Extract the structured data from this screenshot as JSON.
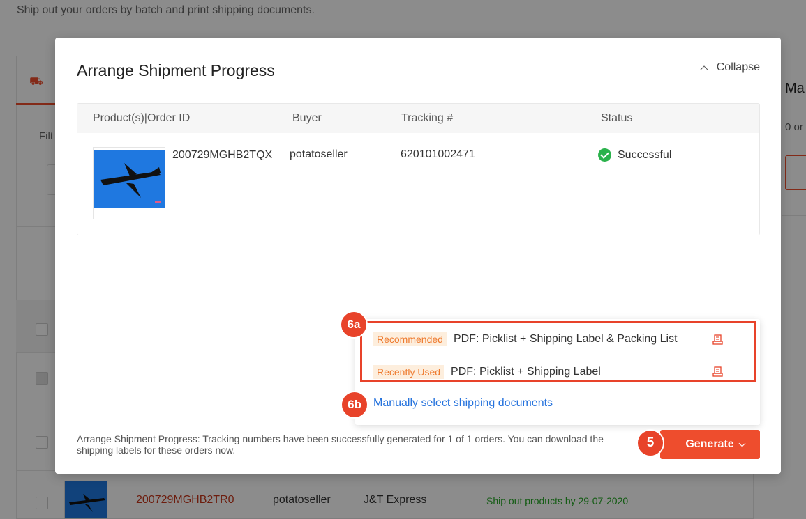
{
  "background": {
    "subtitle": "Ship out your orders by batch and print shipping documents.",
    "filter_label": "Filt",
    "right_title": "Ma",
    "right_count": "0 or",
    "row": {
      "order_id": "200729MGHB2TR0",
      "buyer": "potatoseller",
      "carrier": "J&T Express",
      "ship_by": "Ship out products by 29-07-2020"
    }
  },
  "modal": {
    "title": "Arrange Shipment Progress",
    "collapse_label": "Collapse",
    "table": {
      "headers": [
        "Product(s)|Order ID",
        "Buyer",
        "Tracking #",
        "Status"
      ],
      "rows": [
        {
          "order_id": "200729MGHB2TQX",
          "buyer": "potatoseller",
          "tracking": "620101002471",
          "status": "Successful"
        }
      ]
    },
    "footer_message": "Arrange Shipment Progress: Tracking numbers have been successfully generated for 1 of 1 orders. You can download the shipping labels for these orders now.",
    "generate_label": "Generate"
  },
  "dropdown": {
    "options": [
      {
        "tag": "Recommended",
        "label": "PDF: Picklist + Shipping Label & Packing List"
      },
      {
        "tag": "Recently Used",
        "label": "PDF: Picklist + Shipping Label"
      }
    ],
    "manual_link": "Manually select shipping documents"
  },
  "markers": {
    "m6a": "6a",
    "m6b": "6b",
    "m5": "5"
  },
  "colors": {
    "accent": "#ee4d2d",
    "success": "#2bb24c",
    "link": "#2673dd",
    "marker": "#e8432a"
  }
}
